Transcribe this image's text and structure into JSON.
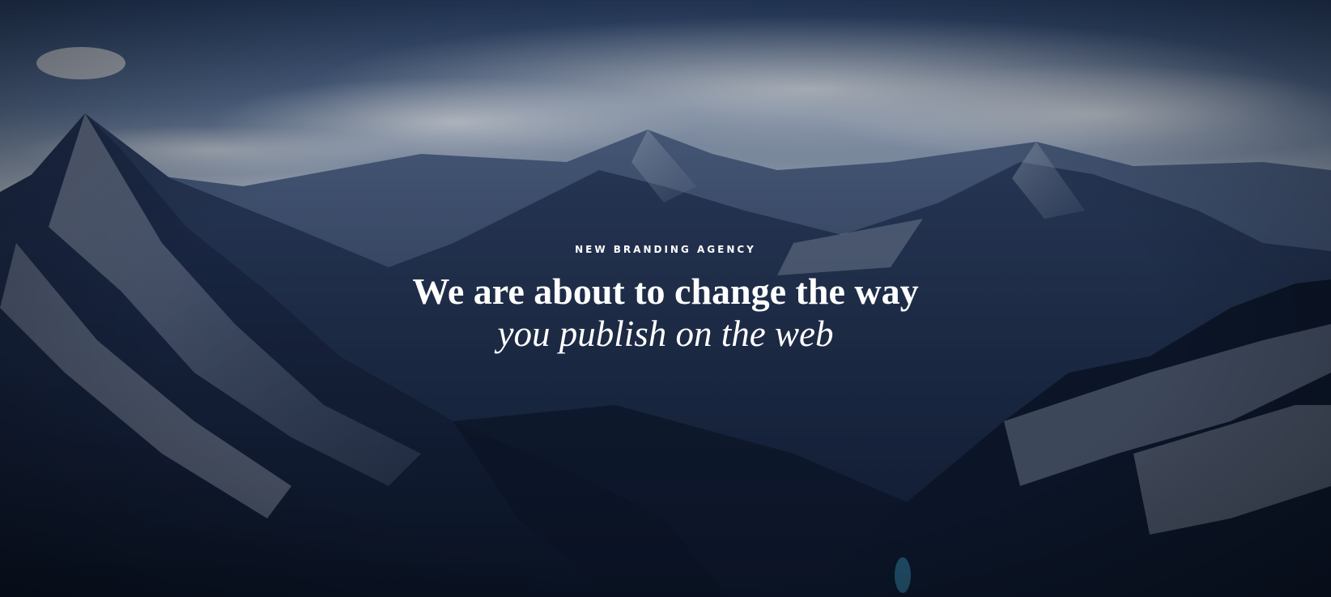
{
  "hero": {
    "eyebrow": "NEW BRANDING AGENCY",
    "headline_line1": "We are about to change the way",
    "headline_line2": "you publish on the web",
    "background_image": "snowy-mountain-range-photo",
    "colors": {
      "text": "#ffffff",
      "sky": "#3d5a86",
      "shadow": "#0d1424"
    }
  }
}
